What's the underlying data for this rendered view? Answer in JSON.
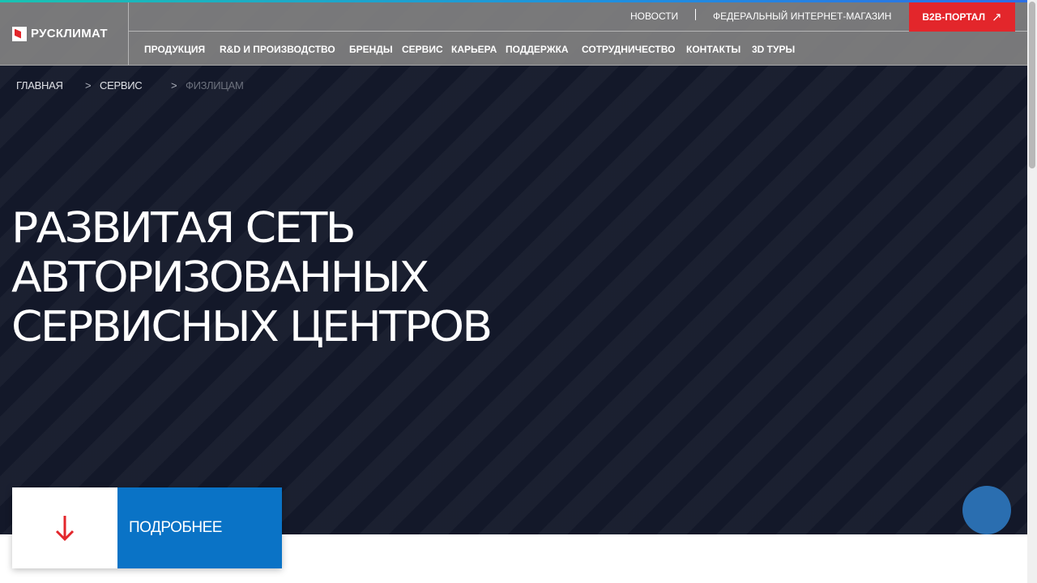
{
  "brand": {
    "name": "РУСКЛИМАТ",
    "accent_color": "#e3262b",
    "hero_color": "#131829",
    "header_color": "#808080",
    "button_color": "#0a73c6"
  },
  "util_nav": {
    "news": "НОВОСТИ",
    "shop": "ФЕДЕРАЛЬНЫЙ ИНТЕРНЕТ-МАГАЗИН",
    "b2b": "B2B-ПОРТАЛ",
    "b2b_icon": "arrow-up-right-icon"
  },
  "main_nav": {
    "items": [
      {
        "label": "ПРОДУКЦИЯ"
      },
      {
        "label": "R&D И ПРОИЗВОДСТВО"
      },
      {
        "label": "БРЕНДЫ"
      },
      {
        "label": "СЕРВИС"
      },
      {
        "label": "КАРЬЕРА"
      },
      {
        "label": "ПОДДЕРЖКА"
      },
      {
        "label": "СОТРУДНИЧЕСТВО"
      },
      {
        "label": "КОНТАКТЫ"
      },
      {
        "label": "3D ТУРЫ"
      }
    ]
  },
  "breadcrumb": {
    "items": [
      {
        "label": "ГЛАВНАЯ"
      },
      {
        "label": "СЕРВИС"
      },
      {
        "label": "ФИЗЛИЦАМ"
      }
    ],
    "separator": ">"
  },
  "hero": {
    "headline_lines": [
      "РАЗВИТАЯ СЕТЬ",
      "АВТОРИЗОВАННЫХ",
      "СЕРВИСНЫХ ЦЕНТРОВ"
    ]
  },
  "details": {
    "label": "ПОДРОБНЕЕ",
    "icon": "arrow-down-icon",
    "icon_color": "#e3262b"
  },
  "chat": {
    "icon": "chat-bubble-icon"
  }
}
